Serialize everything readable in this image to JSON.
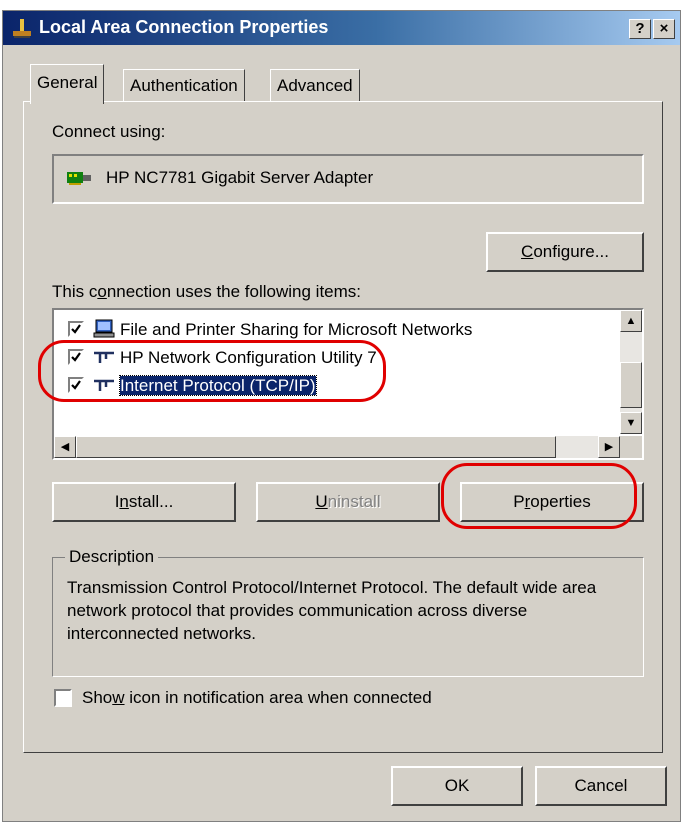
{
  "window": {
    "title": "Local Area Connection Properties",
    "help_button": "?",
    "close_button": "×"
  },
  "tabs": [
    {
      "label": "General",
      "active": true
    },
    {
      "label": "Authentication",
      "active": false
    },
    {
      "label": "Advanced",
      "active": false
    }
  ],
  "general": {
    "connect_using_label": "Connect using:",
    "adapter_name": "HP NC7781 Gigabit Server Adapter",
    "configure_button": {
      "pre": "",
      "accel": "C",
      "post": "onfigure..."
    },
    "items_label": {
      "pre": "This c",
      "accel": "o",
      "post": "nnection uses the following items:"
    },
    "items": [
      {
        "label": "File and Printer Sharing for Microsoft Networks",
        "checked": true,
        "icon": "network-service-icon",
        "selected": false
      },
      {
        "label": "HP Network Configuration Utility 7",
        "checked": true,
        "icon": "protocol-icon",
        "selected": false
      },
      {
        "label": "Internet Protocol (TCP/IP)",
        "checked": true,
        "icon": "protocol-icon",
        "selected": true
      }
    ],
    "install_button": {
      "pre": "I",
      "accel": "n",
      "post": "stall..."
    },
    "uninstall_button": {
      "pre": "",
      "accel": "U",
      "post": "ninstall"
    },
    "properties_button": {
      "pre": "P",
      "accel": "r",
      "post": "operties"
    },
    "description_title": "Description",
    "description_text": "Transmission Control Protocol/Internet Protocol. The default wide area network protocol that provides communication across diverse interconnected networks.",
    "notify_checkbox": {
      "pre": "Sho",
      "accel": "w",
      "post": " icon in notification area when connected",
      "checked": false
    }
  },
  "footer": {
    "ok_button": "OK",
    "cancel_button": "Cancel"
  },
  "colors": {
    "titlebar_start": "#0a246a",
    "titlebar_end": "#a6caf0",
    "face": "#d4d0c8",
    "selection": "#0a246a",
    "highlight_ellipse": "#e00000"
  }
}
